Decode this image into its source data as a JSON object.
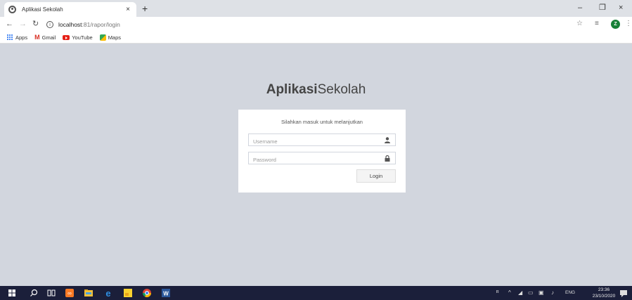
{
  "browser": {
    "tab_title": "Aplikasi Sekolah",
    "tab_close": "×",
    "new_tab": "+",
    "url_host": "localhost",
    "url_path": ":81/rapor/login",
    "profile_initial": "Z",
    "window_controls": {
      "minimize": "–",
      "restore": "❐",
      "close": "×"
    },
    "bookmarks": [
      {
        "label": "Apps",
        "icon": "apps-grid-icon"
      },
      {
        "label": "Gmail",
        "icon": "gmail-icon"
      },
      {
        "label": "YouTube",
        "icon": "youtube-icon"
      },
      {
        "label": "Maps",
        "icon": "maps-icon"
      }
    ]
  },
  "page": {
    "brand_bold": "Aplikasi",
    "brand_light": "Sekolah",
    "login_message": "Silahkan masuk untuk melanjutkan",
    "username_placeholder": "Username",
    "password_placeholder": "Password",
    "login_button": "Login"
  },
  "taskbar": {
    "language": "ENG",
    "time": "23:36",
    "date": "23/10/2020"
  },
  "colors": {
    "page_background": "#d2d6de",
    "taskbar": "#1b1f3a",
    "brand_text": "#444444"
  }
}
